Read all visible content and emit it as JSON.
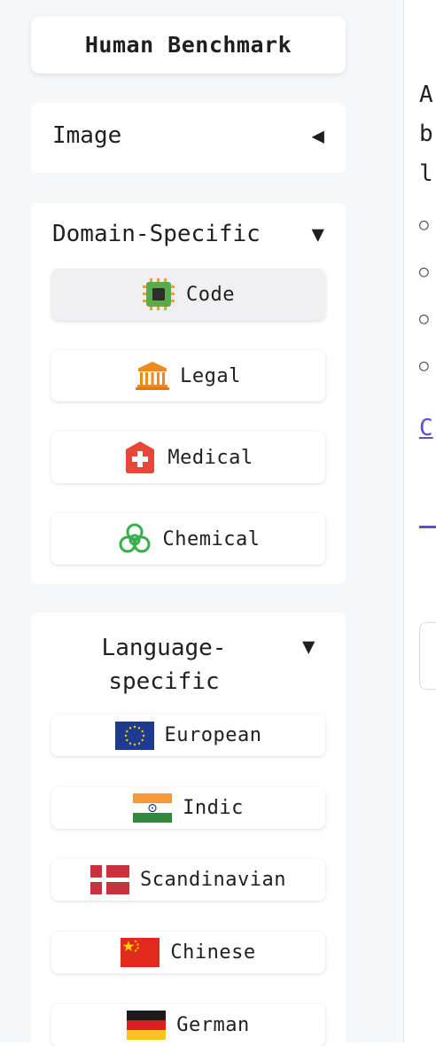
{
  "app_title": "Human Benchmark",
  "image_panel": {
    "label": "Image",
    "arrow": "◀"
  },
  "domain_panel": {
    "label": "Domain-Specific",
    "arrow": "▼",
    "items": [
      {
        "label": "Code",
        "icon": "cpu-chip-icon",
        "active": true
      },
      {
        "label": "Legal",
        "icon": "courthouse-icon"
      },
      {
        "label": "Medical",
        "icon": "medical-cross-icon"
      },
      {
        "label": "Chemical",
        "icon": "biohazard-icon"
      }
    ]
  },
  "language_panel": {
    "label_line1": "Language-",
    "label_line2": "specific",
    "arrow": "▼",
    "items": [
      {
        "label": "European",
        "icon": "eu-flag-icon"
      },
      {
        "label": "Indic",
        "icon": "india-flag-icon"
      },
      {
        "label": "Scandinavian",
        "icon": "denmark-flag-icon"
      },
      {
        "label": "Chinese",
        "icon": "china-flag-icon"
      },
      {
        "label": "German",
        "icon": "germany-flag-icon"
      }
    ]
  },
  "main_partial": {
    "line_chars": [
      "A",
      "b",
      "l"
    ],
    "link_char": "C",
    "bullet_glyph": "○"
  },
  "colors": {
    "accent": "#5a4fcf",
    "sidebar_bg": "#f6f7f9",
    "card_bg": "#ffffff"
  }
}
